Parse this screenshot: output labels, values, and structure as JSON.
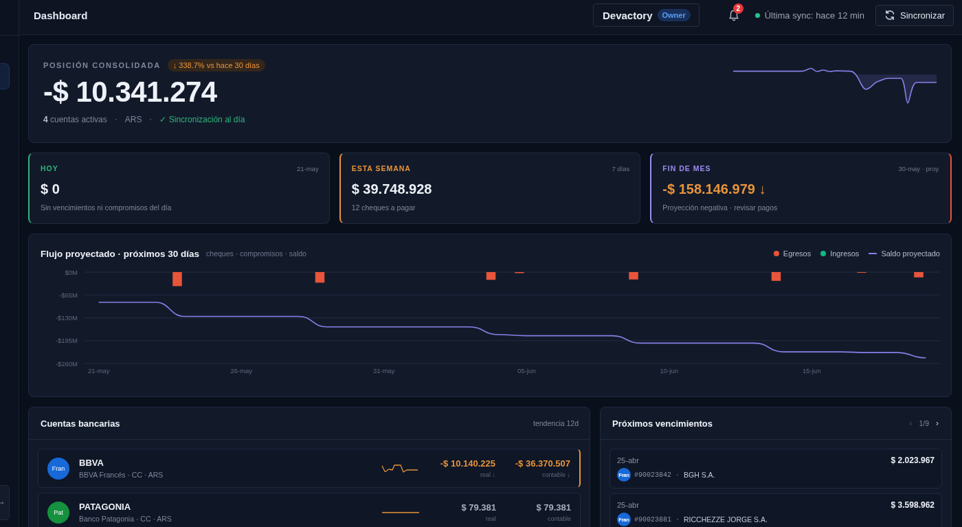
{
  "sidebar": {
    "items": [
      {
        "selected": true
      }
    ]
  },
  "topbar": {
    "title": "Dashboard",
    "org": {
      "name": "Devactory",
      "role": "Owner"
    },
    "notifications": {
      "count": "2"
    },
    "sync": {
      "online": true,
      "label": "Última sync: hace 12 min"
    },
    "sync_button": "Sincronizar"
  },
  "position": {
    "label": "POSICIÓN CONSOLIDADA",
    "change": "↓ 338.7% vs hace 30 días",
    "value": "-$ 10.341.274",
    "meta": [
      {
        "kind": "plain",
        "text": "**4** cuentas activas"
      },
      {
        "kind": "plain",
        "text": "ARS"
      },
      {
        "kind": "ok",
        "text": "✓ Sincronización al día"
      }
    ]
  },
  "summary_cards": [
    {
      "label": "HOY",
      "color": "#2fb37a",
      "date": "21-may",
      "value": "$ 0",
      "note": "Sin vencimientos ni compromisos del día",
      "alert": false
    },
    {
      "label": "ESTA SEMANA",
      "color": "#e8943a",
      "date": "7 días",
      "value": "$ 39.748.928",
      "note": "12 cheques a pagar",
      "alert": false
    },
    {
      "label": "FIN DE MES",
      "color": "#9d8cf0",
      "date": "30-may · proy.",
      "value": "-$ 158.146.979 ↓",
      "note": "Proyección negativa · revisar pagos",
      "alert": true
    }
  ],
  "cashflow": {
    "title": "Flujo proyectado · próximos 30 días",
    "subtitle": "cheques · compromisos · saldo",
    "chart_data": {
      "type": "bar",
      "categories": [
        "21-may",
        null,
        null,
        null,
        null,
        "26-may",
        null,
        null,
        null,
        null,
        "31-may",
        null,
        null,
        null,
        null,
        "05-jun",
        null,
        null,
        null,
        null,
        "10-jun",
        null,
        null,
        null,
        null,
        "15-jun",
        null,
        null,
        null,
        null
      ],
      "stacked": false,
      "grid": true,
      "ylim": [
        -260,
        0
      ],
      "yticks": [
        {
          "value": 0,
          "label": "$0M"
        },
        {
          "value": -65,
          "label": "-$65M"
        },
        {
          "value": -130,
          "label": "-$130M"
        },
        {
          "value": -195,
          "label": "-$195M"
        },
        {
          "value": -260,
          "label": "-$260M"
        }
      ],
      "series": [
        {
          "name": "Egresos",
          "color": "#e8553a",
          "values": [
            0,
            0,
            0,
            -40,
            0,
            0,
            0,
            0,
            -30,
            0,
            0,
            0,
            0,
            0,
            -22,
            -3,
            0,
            0,
            0,
            -21,
            0,
            0,
            0,
            0,
            -25,
            0,
            0,
            -2,
            0,
            -15
          ]
        },
        {
          "name": "Ingresos",
          "color": "#10b981",
          "values": [
            0,
            0,
            0,
            0,
            0,
            0,
            0,
            0,
            0,
            0,
            0,
            0,
            0,
            0,
            0,
            0,
            0,
            0,
            0,
            0,
            0,
            0,
            0,
            0,
            0,
            0,
            0,
            0,
            0,
            0
          ]
        },
        {
          "name": "Saldo proyectado",
          "type": "line",
          "color": "#8b7fe8",
          "values": [
            -86,
            -86,
            -86,
            -126,
            -126,
            -126,
            -126,
            -126,
            -156,
            -156,
            -156,
            -156,
            -156,
            -156,
            -178,
            -181,
            -181,
            -181,
            -181,
            -202,
            -202,
            -202,
            -202,
            -202,
            -227,
            -227,
            -227,
            -229,
            -229,
            -244
          ]
        }
      ]
    }
  },
  "accounts": {
    "title": "Cuentas bancarias",
    "trend_label": "tendencia 12d",
    "rows": [
      {
        "logo": "Fran",
        "color": "#1769d8",
        "name": "BBVA",
        "detail": "BBVA Francés · CC · ARS",
        "real": "-$ 10.140.225",
        "real_label": "real ↓",
        "accounting": "-$ 36.370.507",
        "accounting_label": "contable ↓",
        "negative": true
      },
      {
        "logo": "Pat",
        "color": "#15913f",
        "name": "PATAGONIA",
        "detail": "Banco Patagonia · CC · ARS",
        "real": "$ 79.381",
        "real_label": "real",
        "accounting": "$ 79.381",
        "accounting_label": "contable",
        "negative": false
      }
    ]
  },
  "due": {
    "title": "Próximos vencimientos",
    "pager": {
      "prev": "‹",
      "prev_disabled": true,
      "page": "1/9",
      "next": "›",
      "next_disabled": false
    },
    "items": [
      {
        "date": "25-abr",
        "amount": "$ 2.023.967",
        "bank_logo": "Fran",
        "code": "#90023842",
        "payee": "BGH S.A."
      },
      {
        "date": "25-abr",
        "amount": "$ 3.598.962",
        "bank_logo": "Fran",
        "code": "#90023881",
        "payee": "RICCHEZZE JORGE S.A."
      }
    ]
  }
}
